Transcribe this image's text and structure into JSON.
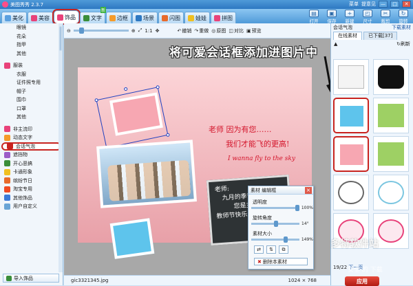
{
  "window": {
    "title": "美图秀秀 2.3.7",
    "menu_label": "菜单",
    "feedback_label": "提意见",
    "min_label": "—",
    "max_label": "□",
    "close_label": "✕"
  },
  "tabs": [
    {
      "label": "美化"
    },
    {
      "label": "美容"
    },
    {
      "label": "饰品"
    },
    {
      "label": "文字"
    },
    {
      "label": "边框"
    },
    {
      "label": "场景"
    },
    {
      "label": "闪图"
    },
    {
      "label": "娃娃"
    },
    {
      "label": "拼图"
    }
  ],
  "new_badge": "新",
  "tools": [
    {
      "label": "打开",
      "glyph": "▤"
    },
    {
      "label": "保存",
      "glyph": "▣"
    },
    {
      "label": "新建",
      "glyph": "+"
    },
    {
      "label": "尺寸",
      "glyph": "◰"
    },
    {
      "label": "裁剪",
      "glyph": "✂"
    },
    {
      "label": "旋转",
      "glyph": "↻"
    }
  ],
  "sidebar": {
    "group1": [
      "眼镜",
      "花朵",
      "指甲",
      "其他"
    ],
    "group2_head": "服装",
    "group2": [
      "衣服",
      "证件照专用",
      "帽子",
      "围巾",
      "口罩",
      "其他"
    ],
    "categories": [
      {
        "label": "非主流印",
        "color": "#e8427a"
      },
      {
        "label": "动态文字",
        "color": "#f59b2a"
      },
      {
        "label": "会话气泡",
        "color": "#c8231f"
      },
      {
        "label": "遮挡物",
        "color": "#9c5cc8"
      },
      {
        "label": "开心恶搞",
        "color": "#3a8e3a"
      },
      {
        "label": "卡通形象",
        "color": "#f0c020"
      },
      {
        "label": "缤纷节日",
        "color": "#e86a2a"
      },
      {
        "label": "淘宝专用",
        "color": "#f04a22"
      },
      {
        "label": "其他饰品",
        "color": "#3a7ad8"
      },
      {
        "label": "用户自定义",
        "color": "#6aa5d6"
      }
    ],
    "import_label": "导入饰品"
  },
  "edit_toolbar": {
    "zoom_label": "1:1",
    "undo": "撤销",
    "redo": "重做",
    "original": "原图",
    "compare": "对比",
    "preview": "预览"
  },
  "canvas": {
    "text_line1": "老师 因为有您……",
    "text_line2": "我们才能飞的更高!",
    "text_en": "I wanna fly to the sky",
    "chalk_lines": [
      "老师:",
      "九月的季节",
      "您是主题!",
      "教师节快乐!"
    ]
  },
  "annotation": "将可爱会话框添加进图片中",
  "status": {
    "filename": "gic3321345.jpg",
    "dimensions": "1024 × 768"
  },
  "material_panel": {
    "title": "素材 编辑框",
    "opacity_label": "透明度",
    "opacity_value": "100%",
    "opacity": 1.0,
    "rotate_label": "旋转角度",
    "rotate_value": "14°",
    "rotate": 0.52,
    "size_label": "素材大小",
    "size_value": "149%",
    "size": 0.74,
    "delete_label": "删除本素材"
  },
  "right_panel": {
    "header": "会话气泡",
    "download_link": "下载素材",
    "tab_online": "在线素材",
    "tab_downloaded": "已下载[37]",
    "refresh": "刷新",
    "pager": "19/22",
    "next_page": "下一页",
    "ok_label": "应用"
  },
  "watermark": "多特软件站",
  "watermark2": "安全 的 下载",
  "colors": {
    "accent": "#c8231f",
    "bubble_blue": "#5ec4ec",
    "bubble_pink": "#f7a7b2",
    "text_red": "#d4162c"
  }
}
